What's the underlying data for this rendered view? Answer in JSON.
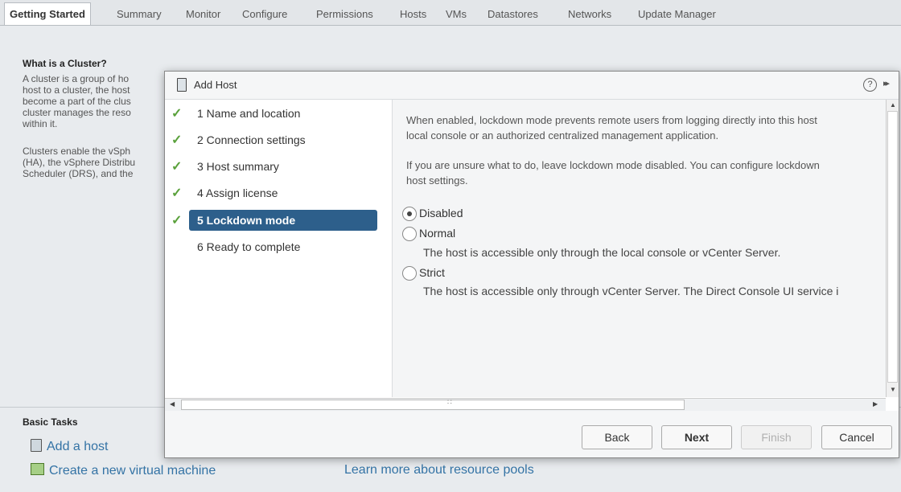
{
  "tabs": [
    "Getting Started",
    "Summary",
    "Monitor",
    "Configure",
    "Permissions",
    "Hosts",
    "VMs",
    "Datastores",
    "Networks",
    "Update Manager"
  ],
  "background": {
    "heading": "What is a Cluster?",
    "para1": [
      "A cluster is a group of ho",
      "host to a cluster, the host",
      "become a part of the clus",
      "cluster manages the reso",
      "within it."
    ],
    "para2": [
      "Clusters enable the vSph",
      "(HA), the vSphere Distribu",
      "Scheduler (DRS), and the"
    ],
    "basic_tasks": "Basic Tasks",
    "add_host": "Add a host",
    "create_vm": "Create a new virtual machine",
    "learn_more": "Learn more about resource pools"
  },
  "dialog": {
    "title": "Add Host",
    "help": "?",
    "expand": "▸▸",
    "steps": [
      {
        "label": "1  Name and location",
        "done": true
      },
      {
        "label": "2  Connection settings",
        "done": true
      },
      {
        "label": "3  Host summary",
        "done": true
      },
      {
        "label": "4  Assign license",
        "done": true
      },
      {
        "label": "5  Lockdown mode",
        "done": true,
        "current": true
      },
      {
        "label": "6  Ready to complete",
        "done": false
      }
    ],
    "content": {
      "intro1": "When enabled, lockdown mode prevents remote users from logging directly into this host",
      "intro2": "local console or an authorized centralized management application.",
      "hint1": "If you are unsure what to do, leave lockdown mode disabled. You can configure lockdown",
      "hint2": "host settings.",
      "options": [
        {
          "label": "Disabled",
          "selected": true,
          "description": ""
        },
        {
          "label": "Normal",
          "selected": false,
          "description": "The host is accessible only through the local console or vCenter Server."
        },
        {
          "label": "Strict",
          "selected": false,
          "description": "The host is accessible only through vCenter Server. The Direct Console UI service i"
        }
      ]
    },
    "buttons": {
      "back": "Back",
      "next": "Next",
      "finish": "Finish",
      "cancel": "Cancel"
    }
  }
}
